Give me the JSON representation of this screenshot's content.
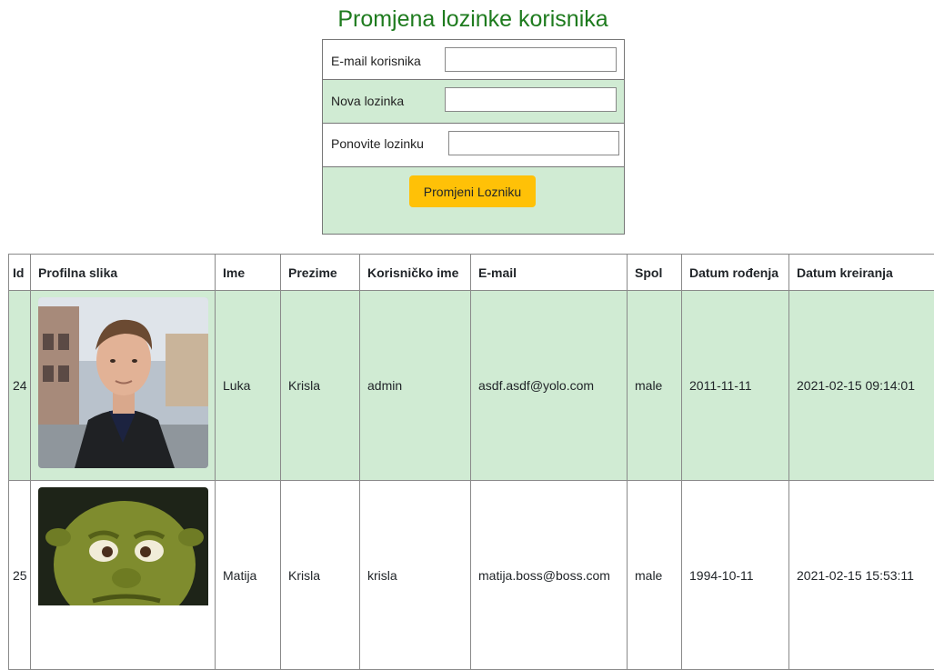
{
  "page": {
    "title": "Promjena lozinke korisnika"
  },
  "form": {
    "email_label": "E-mail korisnika",
    "email_value": "",
    "new_password_label": "Nova lozinka",
    "new_password_value": "",
    "repeat_password_label": "Ponovite lozinku",
    "repeat_password_value": "",
    "submit_label": "Promjeni Lozniku"
  },
  "table": {
    "headers": [
      "Id",
      "Profilna slika",
      "Ime",
      "Prezime",
      "Korisničko ime",
      "E-mail",
      "Spol",
      "Datum rođenja",
      "Datum kreiranja"
    ],
    "rows": [
      {
        "id": "24",
        "avatar": "user-photo-man",
        "ime": "Luka",
        "prezime": "Krisla",
        "korisnicko_ime": "admin",
        "email": "asdf.asdf@yolo.com",
        "spol": "male",
        "datum_rodjenja": "2011-11-11",
        "datum_kreiranja": "2021-02-15 09:14:01"
      },
      {
        "id": "25",
        "avatar": "user-photo-ogre",
        "ime": "Matija",
        "prezime": "Krisla",
        "korisnicko_ime": "krisla",
        "email": "matija.boss@boss.com",
        "spol": "male",
        "datum_rodjenja": "1994-10-11",
        "datum_kreiranja": "2021-02-15 15:53:11"
      }
    ]
  },
  "colors": {
    "title_green": "#1e7b1e",
    "row_green": "#d0ebd3",
    "button_yellow": "#ffc107",
    "border": "#8a8a8a"
  }
}
